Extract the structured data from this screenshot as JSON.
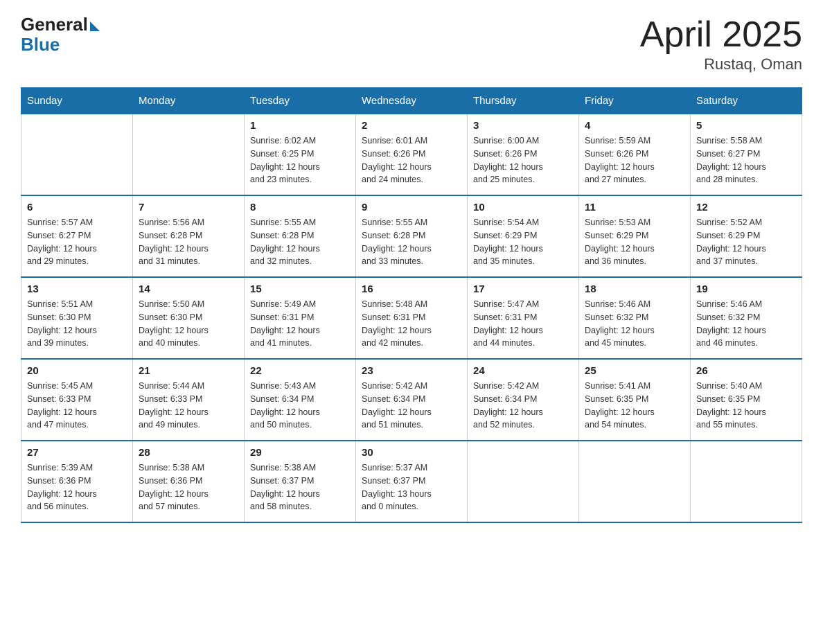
{
  "header": {
    "logo_general": "General",
    "logo_blue": "Blue",
    "title": "April 2025",
    "subtitle": "Rustaq, Oman"
  },
  "calendar": {
    "days_of_week": [
      "Sunday",
      "Monday",
      "Tuesday",
      "Wednesday",
      "Thursday",
      "Friday",
      "Saturday"
    ],
    "weeks": [
      [
        {
          "day": "",
          "info": ""
        },
        {
          "day": "",
          "info": ""
        },
        {
          "day": "1",
          "info": "Sunrise: 6:02 AM\nSunset: 6:25 PM\nDaylight: 12 hours\nand 23 minutes."
        },
        {
          "day": "2",
          "info": "Sunrise: 6:01 AM\nSunset: 6:26 PM\nDaylight: 12 hours\nand 24 minutes."
        },
        {
          "day": "3",
          "info": "Sunrise: 6:00 AM\nSunset: 6:26 PM\nDaylight: 12 hours\nand 25 minutes."
        },
        {
          "day": "4",
          "info": "Sunrise: 5:59 AM\nSunset: 6:26 PM\nDaylight: 12 hours\nand 27 minutes."
        },
        {
          "day": "5",
          "info": "Sunrise: 5:58 AM\nSunset: 6:27 PM\nDaylight: 12 hours\nand 28 minutes."
        }
      ],
      [
        {
          "day": "6",
          "info": "Sunrise: 5:57 AM\nSunset: 6:27 PM\nDaylight: 12 hours\nand 29 minutes."
        },
        {
          "day": "7",
          "info": "Sunrise: 5:56 AM\nSunset: 6:28 PM\nDaylight: 12 hours\nand 31 minutes."
        },
        {
          "day": "8",
          "info": "Sunrise: 5:55 AM\nSunset: 6:28 PM\nDaylight: 12 hours\nand 32 minutes."
        },
        {
          "day": "9",
          "info": "Sunrise: 5:55 AM\nSunset: 6:28 PM\nDaylight: 12 hours\nand 33 minutes."
        },
        {
          "day": "10",
          "info": "Sunrise: 5:54 AM\nSunset: 6:29 PM\nDaylight: 12 hours\nand 35 minutes."
        },
        {
          "day": "11",
          "info": "Sunrise: 5:53 AM\nSunset: 6:29 PM\nDaylight: 12 hours\nand 36 minutes."
        },
        {
          "day": "12",
          "info": "Sunrise: 5:52 AM\nSunset: 6:29 PM\nDaylight: 12 hours\nand 37 minutes."
        }
      ],
      [
        {
          "day": "13",
          "info": "Sunrise: 5:51 AM\nSunset: 6:30 PM\nDaylight: 12 hours\nand 39 minutes."
        },
        {
          "day": "14",
          "info": "Sunrise: 5:50 AM\nSunset: 6:30 PM\nDaylight: 12 hours\nand 40 minutes."
        },
        {
          "day": "15",
          "info": "Sunrise: 5:49 AM\nSunset: 6:31 PM\nDaylight: 12 hours\nand 41 minutes."
        },
        {
          "day": "16",
          "info": "Sunrise: 5:48 AM\nSunset: 6:31 PM\nDaylight: 12 hours\nand 42 minutes."
        },
        {
          "day": "17",
          "info": "Sunrise: 5:47 AM\nSunset: 6:31 PM\nDaylight: 12 hours\nand 44 minutes."
        },
        {
          "day": "18",
          "info": "Sunrise: 5:46 AM\nSunset: 6:32 PM\nDaylight: 12 hours\nand 45 minutes."
        },
        {
          "day": "19",
          "info": "Sunrise: 5:46 AM\nSunset: 6:32 PM\nDaylight: 12 hours\nand 46 minutes."
        }
      ],
      [
        {
          "day": "20",
          "info": "Sunrise: 5:45 AM\nSunset: 6:33 PM\nDaylight: 12 hours\nand 47 minutes."
        },
        {
          "day": "21",
          "info": "Sunrise: 5:44 AM\nSunset: 6:33 PM\nDaylight: 12 hours\nand 49 minutes."
        },
        {
          "day": "22",
          "info": "Sunrise: 5:43 AM\nSunset: 6:34 PM\nDaylight: 12 hours\nand 50 minutes."
        },
        {
          "day": "23",
          "info": "Sunrise: 5:42 AM\nSunset: 6:34 PM\nDaylight: 12 hours\nand 51 minutes."
        },
        {
          "day": "24",
          "info": "Sunrise: 5:42 AM\nSunset: 6:34 PM\nDaylight: 12 hours\nand 52 minutes."
        },
        {
          "day": "25",
          "info": "Sunrise: 5:41 AM\nSunset: 6:35 PM\nDaylight: 12 hours\nand 54 minutes."
        },
        {
          "day": "26",
          "info": "Sunrise: 5:40 AM\nSunset: 6:35 PM\nDaylight: 12 hours\nand 55 minutes."
        }
      ],
      [
        {
          "day": "27",
          "info": "Sunrise: 5:39 AM\nSunset: 6:36 PM\nDaylight: 12 hours\nand 56 minutes."
        },
        {
          "day": "28",
          "info": "Sunrise: 5:38 AM\nSunset: 6:36 PM\nDaylight: 12 hours\nand 57 minutes."
        },
        {
          "day": "29",
          "info": "Sunrise: 5:38 AM\nSunset: 6:37 PM\nDaylight: 12 hours\nand 58 minutes."
        },
        {
          "day": "30",
          "info": "Sunrise: 5:37 AM\nSunset: 6:37 PM\nDaylight: 13 hours\nand 0 minutes."
        },
        {
          "day": "",
          "info": ""
        },
        {
          "day": "",
          "info": ""
        },
        {
          "day": "",
          "info": ""
        }
      ]
    ]
  }
}
